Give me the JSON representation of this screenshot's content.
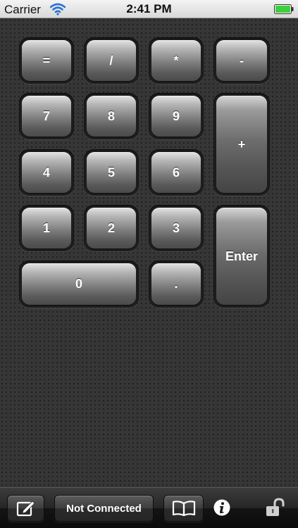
{
  "status_bar": {
    "carrier": "Carrier",
    "time": "2:41 PM",
    "wifi_icon": "wifi-icon",
    "battery_icon": "battery-icon",
    "battery_color": "#3cd13c"
  },
  "keypad": {
    "keys": {
      "equals": "=",
      "divide": "/",
      "multiply": "*",
      "minus": "-",
      "seven": "7",
      "eight": "8",
      "nine": "9",
      "plus": "+",
      "four": "4",
      "five": "5",
      "six": "6",
      "one": "1",
      "two": "2",
      "three": "3",
      "enter": "Enter",
      "zero": "0",
      "decimal": "."
    }
  },
  "toolbar": {
    "connection_status": "Not Connected",
    "icons": [
      "edit-icon",
      "book-icon",
      "info-icon",
      "lock-open-icon"
    ]
  },
  "colors": {
    "background": "#363636",
    "key_top": "#e3e3e3",
    "key_bottom": "#4a4a4a",
    "toolbar": "#1a1a1a"
  }
}
